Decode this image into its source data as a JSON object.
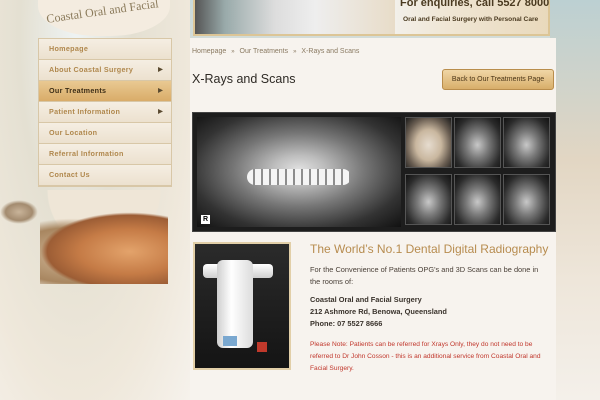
{
  "logo": {
    "text": "Coastal Oral and Facial"
  },
  "banner": {
    "enquiry": "For enquiries, call 5527 8000",
    "tagline": "Oral and Facial Surgery with Personal Care"
  },
  "nav": {
    "items": [
      {
        "label": "Homepage",
        "has_arrow": false,
        "active": false
      },
      {
        "label": "About Coastal Surgery",
        "has_arrow": true,
        "active": false
      },
      {
        "label": "Our Treatments",
        "has_arrow": true,
        "active": true
      },
      {
        "label": "Patient Information",
        "has_arrow": true,
        "active": false
      },
      {
        "label": "Our Location",
        "has_arrow": false,
        "active": false
      },
      {
        "label": "Referral Information",
        "has_arrow": false,
        "active": false
      },
      {
        "label": "Contact Us",
        "has_arrow": false,
        "active": false
      }
    ],
    "arrow_glyph": "▶"
  },
  "breadcrumb": {
    "items": [
      "Homepage",
      "Our Treatments",
      "X-Rays and Scans"
    ],
    "separator": "»"
  },
  "page": {
    "title": "X-Rays and Scans",
    "back_button": "Back to Our Treatments Page",
    "xray_marker": "R",
    "subtitle": "The World’s No.1 Dental Digital Radiography",
    "intro": "For the Convenience of Patients OPG's and 3D Scans can be done in the rooms of:",
    "address_lines": [
      "Coastal Oral and Facial Surgery",
      "212 Ashmore Rd, Benowa, Queensland",
      "Phone: 07 5527 8666"
    ],
    "note": "Please Note: Patients can be referred for Xrays Only, they do not need to be referred to Dr John Cosson - this is an additional service from Coastal Oral and Facial Surgery."
  },
  "colors": {
    "accent_gold": "#b78c4f",
    "nav_active": "#d9ac69",
    "note_red": "#c0362b"
  }
}
